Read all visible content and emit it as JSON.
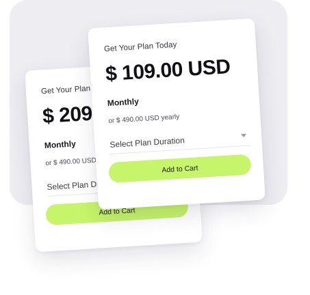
{
  "cards": [
    {
      "eyebrow": "Get Your Plan Today",
      "price": "$ 209.00 USD",
      "plan_name": "Monthly",
      "plan_sub": "or $ 490.00 USD yearly",
      "select_placeholder": "Select Plan Duration",
      "button_label": "Add to Cart"
    },
    {
      "eyebrow": "Get Your Plan Today",
      "price": "$ 109.00 USD",
      "plan_name": "Monthly",
      "plan_sub": "or $ 490.00 USD yearly",
      "select_placeholder": "Select Plan Duration",
      "button_label": "Add to Cart"
    }
  ],
  "colors": {
    "accent": "#c6f46a",
    "panel": "#eeedf2",
    "text": "#111116"
  }
}
